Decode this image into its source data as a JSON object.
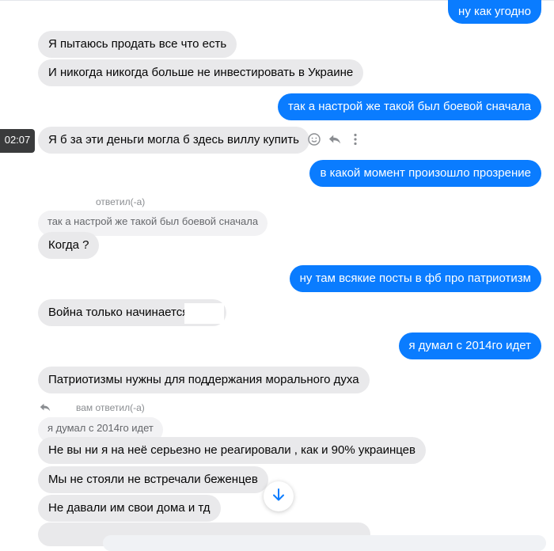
{
  "timestamp": "02:07",
  "messages": {
    "m1": "ну как угодно",
    "m2": "Я пытаюсь продать все что есть",
    "m3": "И никогда никогда больше не инвестировать в Украине",
    "m4": "так а настрой же такой был боевой сначала",
    "m5": "Я б за эти деньги могла б здесь виллу купить",
    "m6": "в какой момент произошло прозрение",
    "reply1_note": "ответил(-а)",
    "reply1_quote": "так а настрой же такой был боевой сначала",
    "m7": "Когда ?",
    "m8": "ну там всякие посты в фб про патриотизм",
    "m9": "Война только начинается",
    "m10": "я думал с 2014го идет",
    "m11": "Патриотизмы нужны для поддержания морального духа",
    "reply2_note": "вам ответил(-а)",
    "reply2_quote": "я думал с 2014го идет",
    "m12": "Не вы ни я на неё серьезно не реагировали , как и 90% украинцев",
    "m13": "Мы не стояли не встречали беженцев",
    "m14": "Не давали им свои дома и тд"
  },
  "colors": {
    "outgoing": "#0a7cff",
    "incoming": "#e9e9eb"
  },
  "icons": [
    "smile-icon",
    "reply-icon",
    "more-icon",
    "arrow-down-icon",
    "reply-arrow-icon"
  ]
}
